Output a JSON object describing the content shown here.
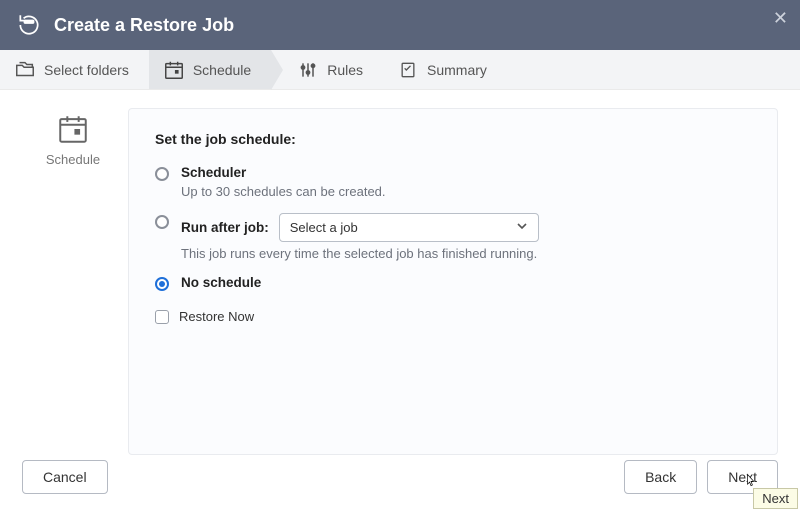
{
  "window": {
    "title": "Create a Restore Job"
  },
  "steps": {
    "select_folders": "Select folders",
    "schedule": "Schedule",
    "rules": "Rules",
    "summary": "Summary"
  },
  "side": {
    "label": "Schedule"
  },
  "panel": {
    "heading": "Set the job schedule:",
    "scheduler": {
      "label": "Scheduler",
      "help": "Up to 30 schedules can be created."
    },
    "run_after": {
      "label": "Run after job:",
      "help": "This job runs every time the selected job has finished running.",
      "select_placeholder": "Select a job"
    },
    "no_schedule": {
      "label": "No schedule"
    },
    "restore_now": "Restore Now"
  },
  "footer": {
    "cancel": "Cancel",
    "back": "Back",
    "next": "Next"
  },
  "tooltip": "Next"
}
